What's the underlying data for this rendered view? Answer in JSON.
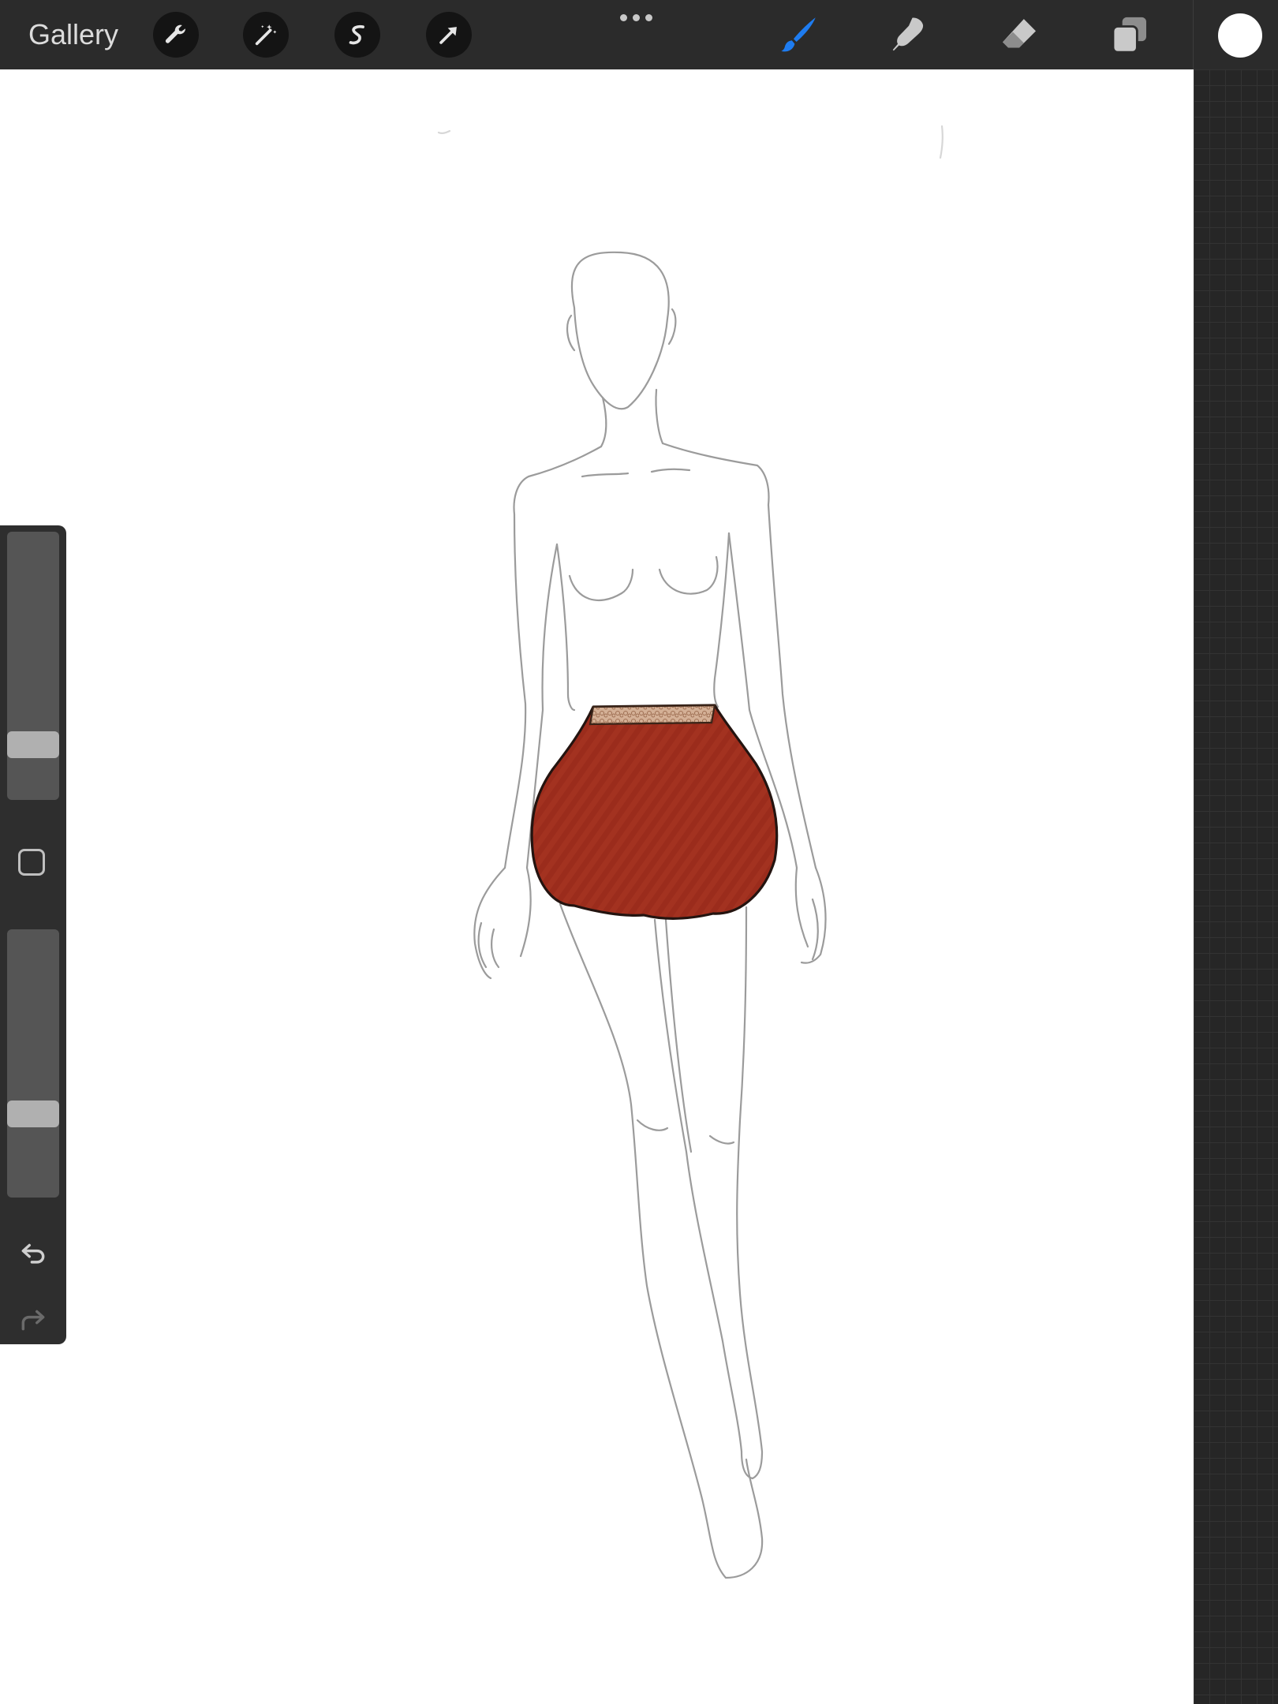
{
  "toolbar": {
    "gallery_label": "Gallery",
    "left_tools": [
      "wrench-icon",
      "magic-wand-icon",
      "selection-icon",
      "transform-arrow-icon"
    ],
    "right_tools": [
      "brush-icon",
      "smudge-icon",
      "eraser-icon",
      "layers-icon"
    ],
    "active_tool": "brush",
    "active_color": "#ffffff",
    "accent": "#1e7cf0"
  },
  "sidebar": {
    "brush_size_level": 0.24,
    "opacity_level": 0.31
  },
  "canvas": {
    "drawing": "fashion-croquis-with-red-skirt",
    "skirt_color": "#a0301f",
    "waistband_color": "#c8a58a"
  }
}
